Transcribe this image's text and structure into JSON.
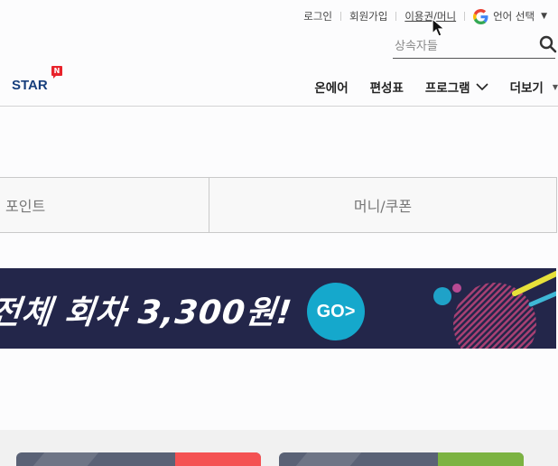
{
  "util": {
    "login": "로그인",
    "signup": "회원가입",
    "ticket_money": "이용권/머니",
    "language": "언어 선택"
  },
  "search": {
    "placeholder": "상속자들"
  },
  "logo": {
    "text": "STAR",
    "badge": "N"
  },
  "nav": {
    "items": [
      "온에어",
      "편성표",
      "프로그램",
      "더보기"
    ]
  },
  "tabs": {
    "left": "포인트",
    "right": "머니/쿠폰"
  },
  "banner": {
    "text": "전체 회차  3,300원!",
    "go": "GO>"
  },
  "colors": {
    "logo": "#163e7c",
    "badge": "#e8232b",
    "banner_bg": "#23264a",
    "go_button": "#15a8cc",
    "card1_accent": "#f45253",
    "card2_accent": "#7cb342"
  }
}
